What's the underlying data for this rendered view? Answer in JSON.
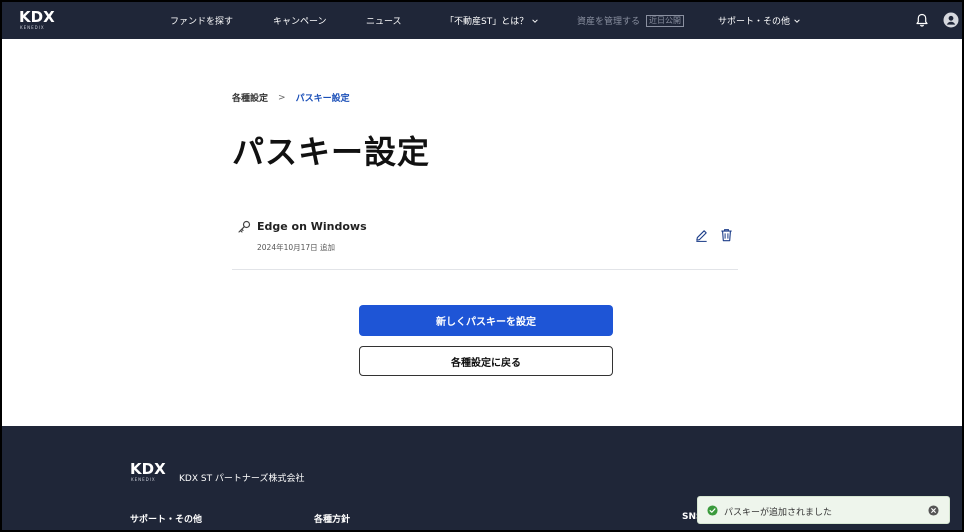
{
  "header": {
    "logo": "KDX",
    "logo_sub": "KENEDIX",
    "nav": {
      "fund": "ファンドを探す",
      "campaign": "キャンペーン",
      "news": "ニュース",
      "about": "「不動産ST」とは？",
      "manage": "資産を管理する",
      "manage_tag": "近日公開",
      "support": "サポート・その他"
    }
  },
  "breadcrumb": {
    "root": "各種設定",
    "separator": ">",
    "current": "パスキー設定"
  },
  "page": {
    "title": "パスキー設定"
  },
  "passkey": {
    "name": "Edge on Windows",
    "added": "2024年10月17日 追加"
  },
  "buttons": {
    "new_passkey": "新しくパスキーを設定",
    "back": "各種設定に戻る"
  },
  "footer": {
    "logo": "KDX",
    "logo_sub": "KENEDIX",
    "company": "KDX ST パートナーズ株式会社",
    "col_support": "サポート・その他",
    "col_policy": "各種方針",
    "col_sns": "SNS"
  },
  "toast": {
    "message": "パスキーが追加されました"
  },
  "colors": {
    "header_bg": "#1f2638",
    "primary": "#1e55d6",
    "accent_link": "#1a4fb8",
    "toast_bg": "#eef5ec",
    "success": "#3a9a3c"
  },
  "icons": [
    "bell-icon",
    "user-avatar-icon",
    "chevron-down-icon",
    "key-icon",
    "edit-icon",
    "trash-icon",
    "check-circle-icon",
    "close-circle-icon"
  ]
}
